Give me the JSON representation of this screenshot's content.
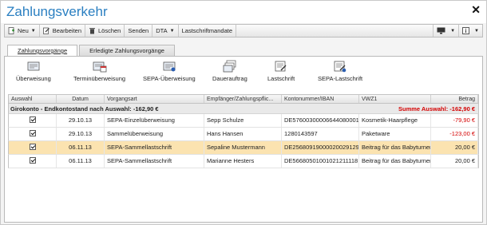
{
  "window": {
    "title": "Zahlungsverkehr",
    "close_label": "✕"
  },
  "toolbar": {
    "items": [
      {
        "label": "Neu",
        "icon": "new-document-icon",
        "caret": "▼"
      },
      {
        "label": "Bearbeiten",
        "icon": "edit-icon"
      },
      {
        "label": "Löschen",
        "icon": "trash-icon"
      },
      {
        "label": "Senden"
      },
      {
        "label": "DTA",
        "caret": "▼"
      },
      {
        "label": "Lastschriftmandate"
      }
    ],
    "right": [
      {
        "icon": "monitor-icon",
        "caret": "▼"
      },
      {
        "icon": "info-icon",
        "caret": "▼"
      }
    ]
  },
  "tabs": [
    {
      "label": "Zahlungsvorgänge",
      "active": true
    },
    {
      "label": "Erledigte Zahlungsvorgänge",
      "active": false
    }
  ],
  "actions": [
    {
      "label": "Überweisung",
      "icon": "transfer-icon"
    },
    {
      "label": "Terminüberweisung",
      "icon": "scheduled-transfer-icon"
    },
    {
      "label": "SEPA-Überweisung",
      "icon": "sepa-transfer-icon"
    },
    {
      "label": "Dauerauftrag",
      "icon": "standing-order-icon"
    },
    {
      "label": "Lastschrift",
      "icon": "direct-debit-icon"
    },
    {
      "label": "SEPA-Lastschrift",
      "icon": "sepa-direct-debit-icon"
    }
  ],
  "table": {
    "columns": [
      "Auswahl",
      "Datum",
      "Vorgangsart",
      "Empfänger/Zahlungspflic...",
      "Kontonummer/IBAN",
      "VWZ1",
      "Betrag"
    ],
    "group": {
      "label": "Girokonto - Endkontostand nach Auswahl: -162,90 €",
      "summary": "Summe Auswahl: -162,90 €"
    },
    "rows": [
      {
        "checked": true,
        "date": "29.10.13",
        "type": "SEPA-Einzelüberweisung",
        "recipient": "Sepp Schulze",
        "account": "DE57600300006644080001",
        "purpose": "Kosmetik-Haarpflege",
        "amount": "-79,90 €",
        "negative": true,
        "selected": false
      },
      {
        "checked": true,
        "date": "29.10.13",
        "type": "Sammelüberweisung",
        "recipient": "Hans Hansen",
        "account": "1280143597",
        "purpose": "Paketware",
        "amount": "-123,00 €",
        "negative": true,
        "selected": false
      },
      {
        "checked": true,
        "date": "06.11.13",
        "type": "SEPA-Sammellastschrift",
        "recipient": "Sepaline Mustermann",
        "account": "DE25680919000020029129",
        "purpose": "Beitrag für das Babyturnen",
        "amount": "20,00 €",
        "negative": false,
        "selected": true
      },
      {
        "checked": true,
        "date": "06.11.13",
        "type": "SEPA-Sammellastschrift",
        "recipient": "Marianne Hesters",
        "account": "DE56680501001021211118",
        "purpose": "Beitrag für das Babyturnen",
        "amount": "20,00 €",
        "negative": false,
        "selected": false
      }
    ]
  }
}
